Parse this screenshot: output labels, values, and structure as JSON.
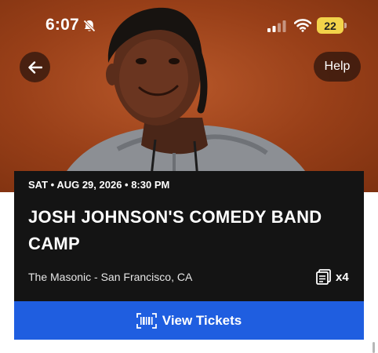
{
  "status_bar": {
    "time": "6:07",
    "battery": "22"
  },
  "header": {
    "help_label": "Help"
  },
  "event": {
    "date_time": "SAT • AUG 29, 2026 • 8:30 PM",
    "title": "JOSH JOHNSON'S COMEDY BAND CAMP",
    "venue": "The Masonic - San Francisco, CA",
    "ticket_quantity": "x4"
  },
  "actions": {
    "view_tickets_label": "View Tickets"
  },
  "icons": {
    "back": "arrow-left-icon",
    "mute": "bell-slash-icon",
    "signal": "cellular-signal-icon",
    "wifi": "wifi-icon",
    "tickets": "tickets-icon",
    "barcode": "barcode-icon"
  },
  "colors": {
    "hero_background": "#983f18",
    "card_background": "#141414",
    "primary_button": "#1f5ee0",
    "battery": "#f2d34a"
  }
}
